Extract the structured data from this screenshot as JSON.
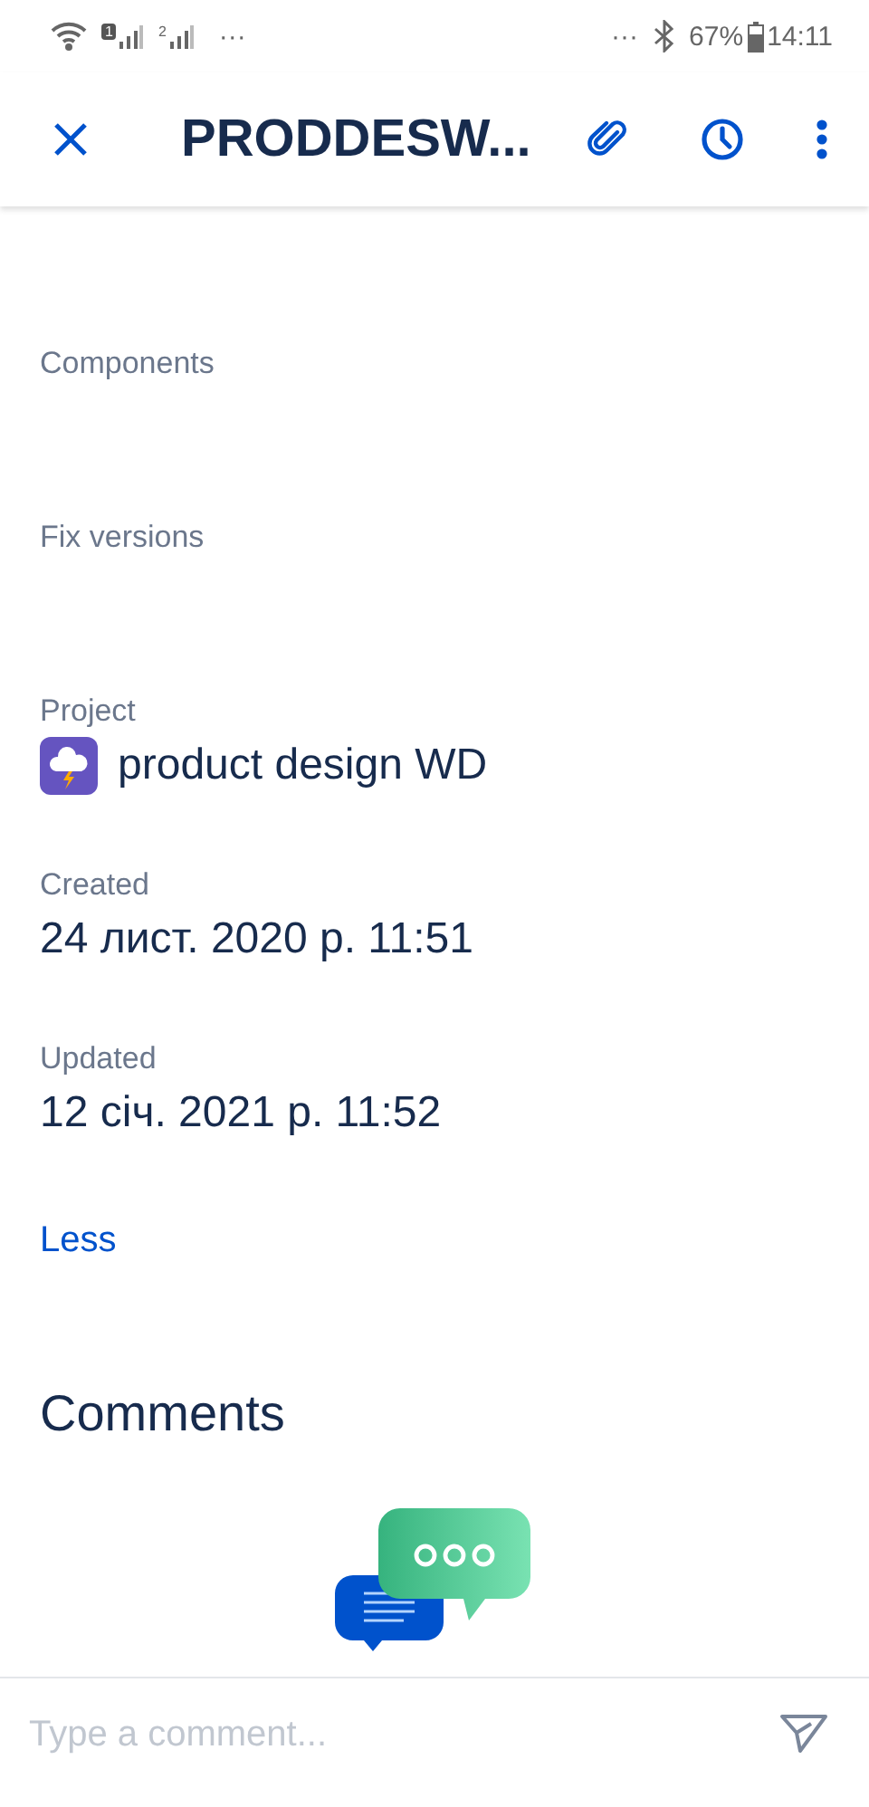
{
  "status_bar": {
    "sim_1": "1",
    "sim_2": "2",
    "left_more": "···",
    "right_more": "···",
    "battery": "67%",
    "time": "14:11"
  },
  "header": {
    "title": "PRODDESW..."
  },
  "fields": [
    {
      "kind": "empty",
      "label": "Components"
    },
    {
      "kind": "empty",
      "label": "Fix versions"
    },
    {
      "kind": "project",
      "label": "Project",
      "value": "product design WD"
    },
    {
      "kind": "text",
      "label": "Created",
      "value": "24 лист. 2020 р. 11:51"
    },
    {
      "kind": "text",
      "label": "Updated",
      "value": "12 січ. 2021 р. 11:52"
    }
  ],
  "less_link": "Less",
  "comments": {
    "title": "Comments"
  },
  "comment_bar": {
    "placeholder": "Type a comment..."
  }
}
